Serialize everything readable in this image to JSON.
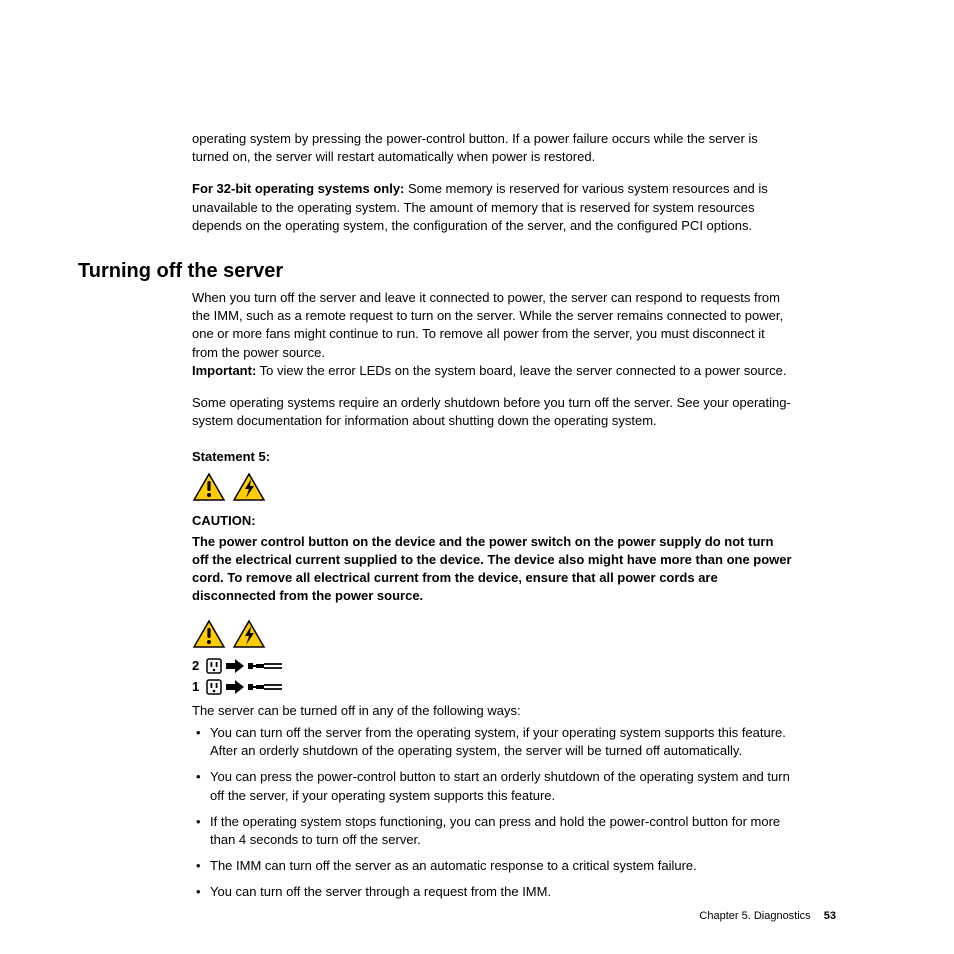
{
  "para_top1": "operating system by pressing the power-control button. If a power failure occurs while the server is turned on, the server will restart automatically when power is restored.",
  "para_top2_bold": "For 32-bit operating systems only:",
  "para_top2_rest": " Some memory is reserved for various system resources and is unavailable to the operating system. The amount of memory that is reserved for system resources depends on the operating system, the configuration of the server, and the configured PCI options.",
  "heading": "Turning off the server",
  "para_h1": "When you turn off the server and leave it connected to power, the server can respond to requests from the IMM, such as a remote request to turn on the server. While the server remains connected to power, one or more fans might continue to run. To remove all power from the server, you must disconnect it from the power source.",
  "para_h1_imp_bold": "Important:",
  "para_h1_imp_rest": " To view the error LEDs on the system board, leave the server connected to a power source.",
  "para_h2": "Some operating systems require an orderly shutdown before you turn off the server. See your operating-system documentation for information about shutting down the operating system.",
  "statement_label": "Statement 5:",
  "caution_label": "CAUTION:",
  "caution_text": "The power control button on the device and the power switch on the power supply do not turn off the electrical current supplied to the device. The device also might have more than one power cord. To remove all electrical current from the device, ensure that all power cords are disconnected from the power source.",
  "cord_label_2": "2",
  "cord_label_1": "1",
  "para_list_intro": "The server can be turned off in any of the following ways:",
  "bullets": [
    "You can turn off the server from the operating system, if your operating system supports this feature. After an orderly shutdown of the operating system, the server will be turned off automatically.",
    "You can press the power-control button to start an orderly shutdown of the operating system and turn off the server, if your operating system supports this feature.",
    "If the operating system stops functioning, you can press and hold the power-control button for more than 4 seconds to turn off the server.",
    "The IMM can turn off the server as an automatic response to a critical system failure.",
    "You can turn off the server through a request from the IMM."
  ],
  "footer_chapter": "Chapter 5. Diagnostics",
  "footer_page": "53"
}
